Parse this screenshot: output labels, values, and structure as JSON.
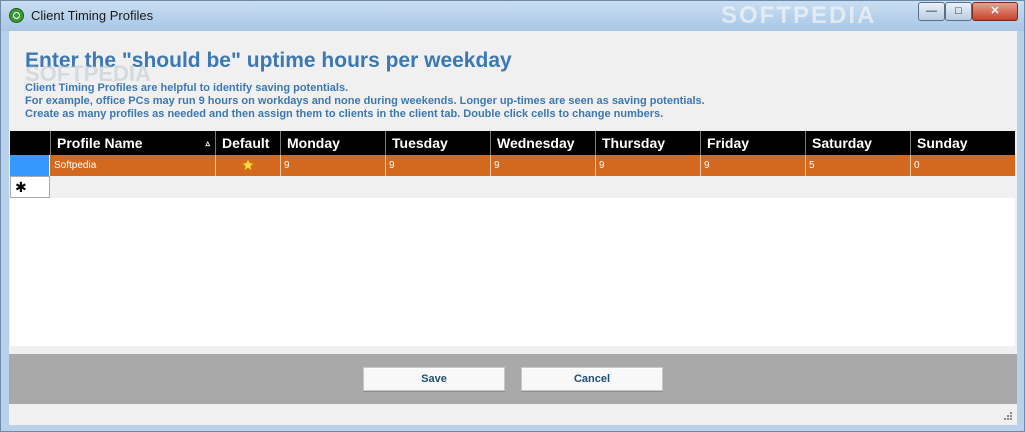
{
  "window": {
    "title": "Client Timing Profiles",
    "watermark": "SOFTPEDIA",
    "minimize_glyph": "—",
    "maximize_glyph": "□",
    "close_glyph": "✕"
  },
  "content": {
    "heading": "Enter the \"should be\" uptime hours per weekday",
    "heading_watermark": "SOFTPEDIA",
    "desc_line1": "Client Timing Profiles are helpful to identify saving potentials.",
    "desc_line2": "For example, office PCs may run 9 hours on workdays and none during weekends.  Longer up-times are seen as saving potentials.",
    "desc_line3": "Create as many profiles as needed and then assign them to clients in the client tab. Double click cells to change numbers."
  },
  "grid": {
    "columns": [
      "Profile Name",
      "Default",
      "Monday",
      "Tuesday",
      "Wednesday",
      "Thursday",
      "Friday",
      "Saturday",
      "Sunday"
    ],
    "sort_glyph": "▵",
    "rows": [
      {
        "profile_name": "Softpedia",
        "default": true,
        "monday": "9",
        "tuesday": "9",
        "wednesday": "9",
        "thursday": "9",
        "friday": "9",
        "saturday": "5",
        "sunday": "0"
      }
    ],
    "new_row_glyph": "✱",
    "colors": {
      "header_bg": "#000000",
      "selected_row_bg": "#d2691e",
      "row_selector": "#3399ff"
    },
    "icons": {
      "default": "star-icon",
      "sort": "sort-ascending-icon"
    }
  },
  "footer": {
    "save_label": "Save",
    "cancel_label": "Cancel"
  },
  "colors": {
    "accent": "#3b78b4",
    "footer_bg": "#a9a9a9"
  }
}
